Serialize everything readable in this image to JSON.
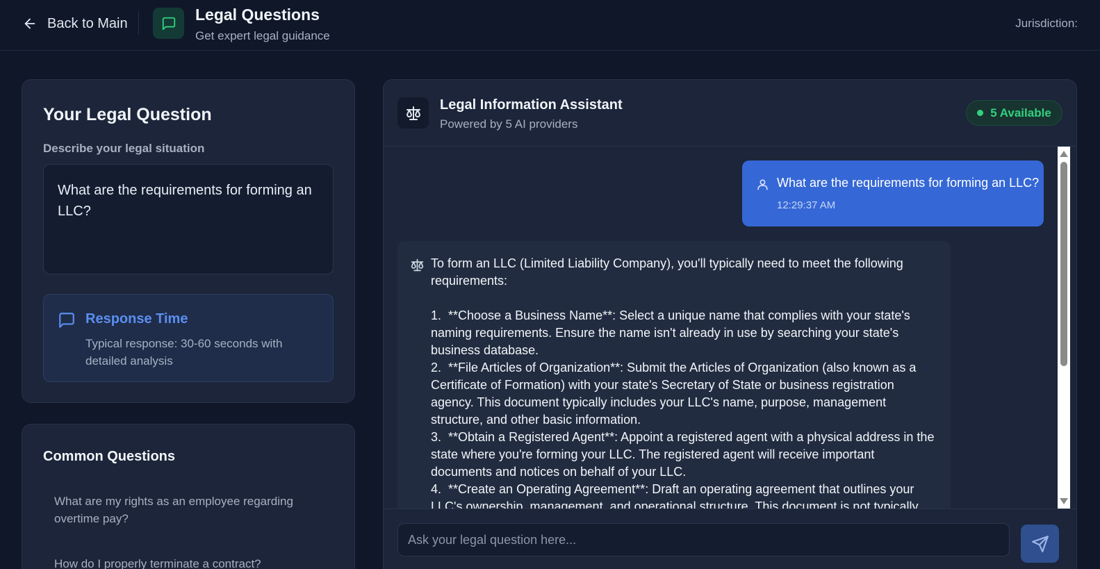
{
  "header": {
    "back_label": "Back to Main",
    "title": "Legal Questions",
    "subtitle": "Get expert legal guidance",
    "jurisdiction_label": "Jurisdiction:"
  },
  "question_card": {
    "title": "Your Legal Question",
    "field_label": "Describe your legal situation",
    "question_text": "What are the requirements for forming an LLC?",
    "response_time": {
      "title": "Response Time",
      "text": "Typical response: 30-60 seconds with detailed analysis"
    }
  },
  "common_questions": {
    "title": "Common Questions",
    "items": [
      "What are my rights as an employee regarding overtime pay?",
      "How do I properly terminate a contract?"
    ]
  },
  "chat": {
    "assistant_name": "Legal Information Assistant",
    "assistant_sub": "Powered by 5 AI providers",
    "badge": "5 Available",
    "user_message": {
      "text": "What are the requirements for forming an LLC?",
      "time": "12:29:37 AM"
    },
    "bot_message": "To form an LLC (Limited Liability Company), you'll typically need to meet the following requirements:\n\n1.  **Choose a Business Name**: Select a unique name that complies with your state's naming requirements. Ensure the name isn't already in use by searching your state's business database.\n2.  **File Articles of Organization**: Submit the Articles of Organization (also known as a Certificate of Formation) with your state's Secretary of State or business registration agency. This document typically includes your LLC's name, purpose, management structure, and other basic information.\n3.  **Obtain a Registered Agent**: Appoint a registered agent with a physical address in the state where you're forming your LLC. The registered agent will receive important documents and notices on behalf of your LLC.\n4.  **Create an Operating Agreement**: Draft an operating agreement that outlines your LLC's ownership, management, and operational structure. This document is not typically filed with",
    "input_placeholder": "Ask your legal question here..."
  },
  "colors": {
    "background": "#0f1729",
    "card": "#1c2539",
    "accent_blue": "#3567d6",
    "accent_green": "#34d07f",
    "link_blue": "#5b8ef0"
  },
  "icons": {
    "back": "arrow-left-icon",
    "header": "message-square-icon",
    "response": "message-square-icon",
    "assistant": "scale-icon",
    "user": "user-icon",
    "bot": "scale-icon",
    "send": "send-icon"
  }
}
